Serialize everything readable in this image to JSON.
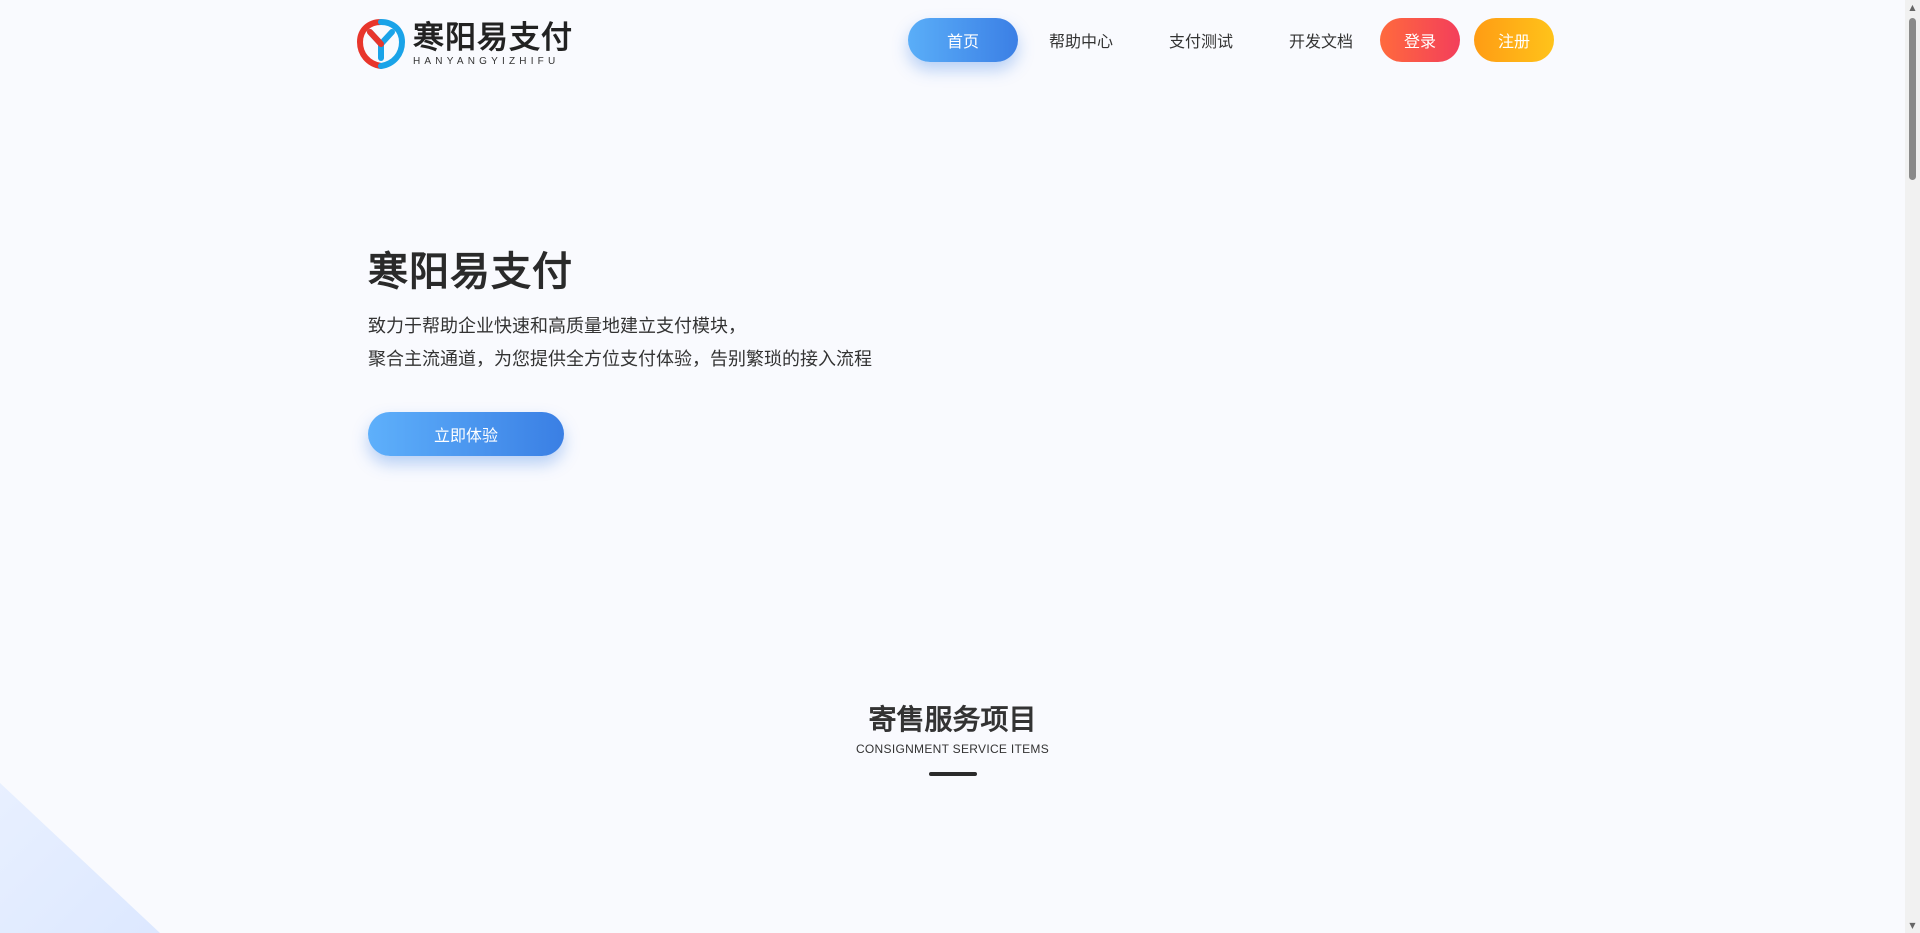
{
  "logo": {
    "name_cn": "寒阳易支付",
    "name_en": "HANYANGYIZHIFU",
    "icon": "y-shield-logo-icon",
    "colors": {
      "red": "#e8352b",
      "blue": "#1aa3e8"
    }
  },
  "nav": {
    "items": [
      {
        "label": "首页",
        "active": true
      },
      {
        "label": "帮助中心",
        "active": false
      },
      {
        "label": "支付测试",
        "active": false
      },
      {
        "label": "开发文档",
        "active": false
      }
    ],
    "login_label": "登录",
    "register_label": "注册"
  },
  "hero": {
    "title": "寒阳易支付",
    "desc_line1": "致力于帮助企业快速和高质量地建立支付模块，",
    "desc_line2": "聚合主流通道，为您提供全方位支付体验，告别繁琐的接入流程",
    "cta_label": "立即体验"
  },
  "section": {
    "title": "寄售服务项目",
    "subtitle": "CONSIGNMENT SERVICE ITEMS"
  },
  "colors": {
    "primary_gradient_start": "#5eb0fb",
    "primary_gradient_end": "#3a7fe4",
    "login_gradient_start": "#ff6a3d",
    "login_gradient_end": "#f33e5b",
    "register_gradient_start": "#ff9c14",
    "register_gradient_end": "#ffc31a",
    "page_background": "#f9fafe"
  }
}
